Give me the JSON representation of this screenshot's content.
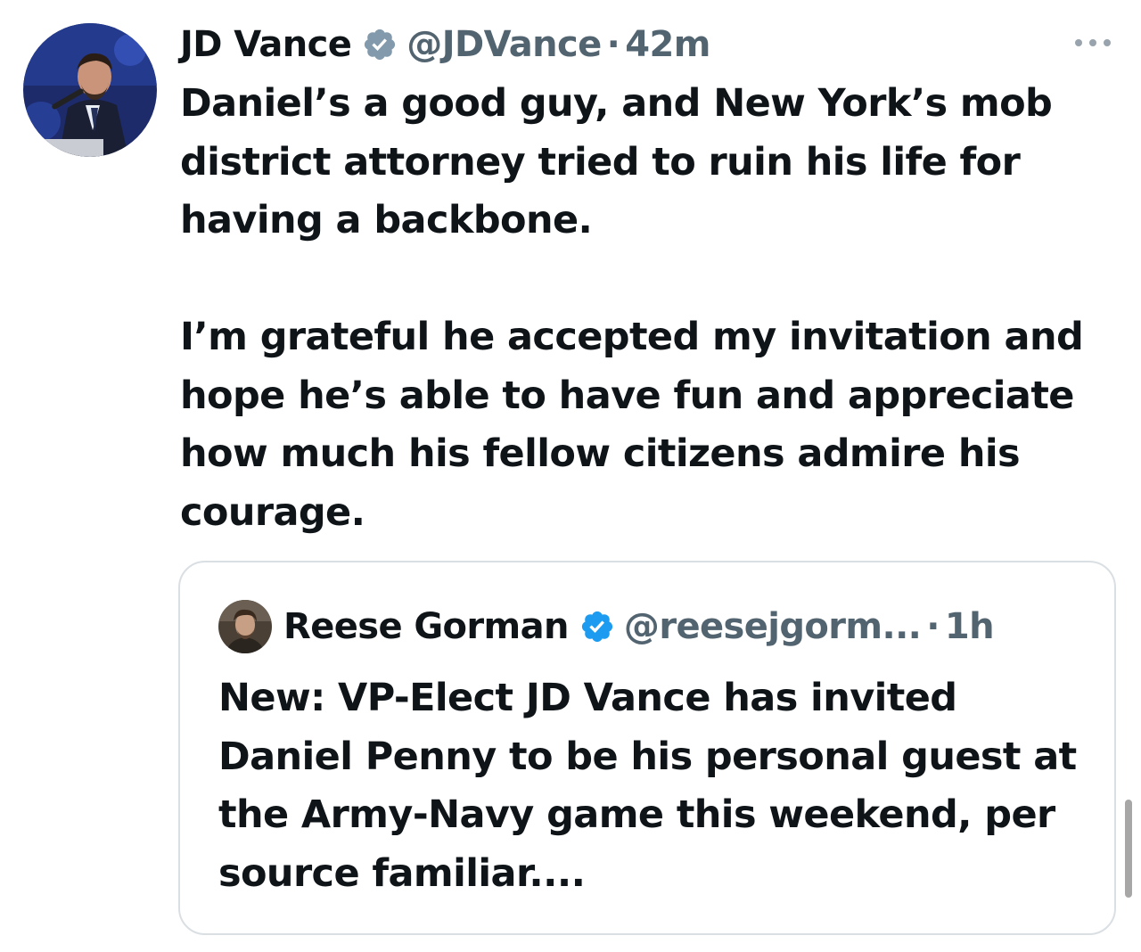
{
  "tweet": {
    "author_name": "JD Vance",
    "handle": "@JDVance",
    "separator": "·",
    "time": "42m",
    "paragraphs": [
      "Daniel’s a good guy, and New York’s mob district attorney tried to ruin his life for having a backbone.",
      "I’m grateful he accepted my invitation and hope he’s able to have fun and appreciate how much his fellow citizens admire his courage."
    ],
    "badge_color": "#829aab",
    "avatar_icon": "profile-photo"
  },
  "quoted_tweet": {
    "author_name": "Reese Gorman",
    "handle": "@reesejgorm...",
    "separator": "·",
    "time": "1h",
    "text": "New: VP-Elect JD Vance has invited Daniel Penny to be his personal guest at the Army-Navy game this weekend, per source familiar....",
    "badge_color": "#1d9bf0",
    "avatar_icon": "profile-photo"
  },
  "icons": {
    "more": "more-options-icon",
    "verified": "verified-badge-icon"
  },
  "colors": {
    "text": "#0f1419",
    "secondary": "#536471",
    "border": "#dadfe3"
  }
}
